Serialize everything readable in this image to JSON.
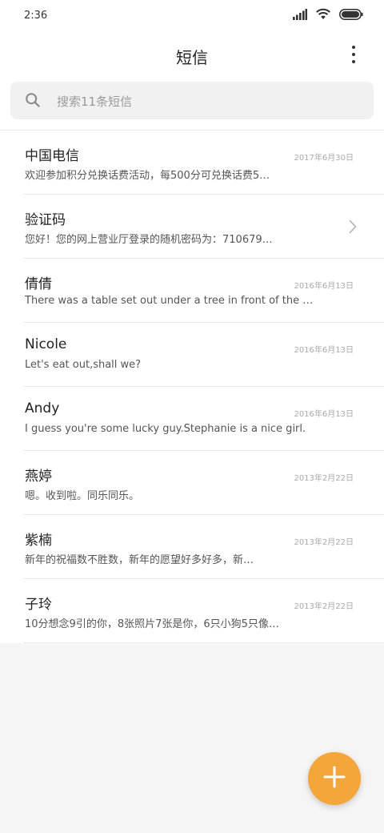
{
  "status_bar": {
    "time": "2:36",
    "icons": [
      "signal-icon",
      "wifi-icon",
      "battery-icon"
    ]
  },
  "header": {
    "title": "短信",
    "menu_icon": "more-vert-icon"
  },
  "search": {
    "placeholder": "搜索11条短信",
    "icon": "search-icon"
  },
  "messages": [
    {
      "name": "中国电信",
      "date": "2017年6月30日",
      "preview": "欢迎参加积分兑换话费活动，每500分可兑换话费5…",
      "chevron": false
    },
    {
      "name": "验证码",
      "date": "",
      "preview": "您好！您的网上营业厅登录的随机密码为：710679…",
      "chevron": true
    },
    {
      "name": "倩倩",
      "date": "2016年6月13日",
      "preview": "There was a table set out under a tree in front of the hous",
      "chevron": false
    },
    {
      "name": "Nicole",
      "date": "2016年6月13日",
      "preview": "Let's eat out,shall we?",
      "chevron": false
    },
    {
      "name": "Andy",
      "date": "2016年6月13日",
      "preview": "I guess you're some lucky guy.Stephanie is a nice girl.",
      "chevron": false
    },
    {
      "name": "燕婷",
      "date": "2013年2月22日",
      "preview": "嗯。收到啦。同乐同乐。",
      "chevron": false
    },
    {
      "name": "紫楠",
      "date": "2013年2月22日",
      "preview": "新年的祝福数不胜数，新年的愿望好多好多，新…",
      "chevron": false
    },
    {
      "name": "子玲",
      "date": "2013年2月22日",
      "preview": "10分想念9引的你，8张照片7张是你，6只小狗5只像…",
      "chevron": false
    }
  ],
  "fab": {
    "icon": "plus-icon",
    "color": "#f5a63a"
  },
  "colors": {
    "background": "#f5f5f5",
    "surface": "#ffffff",
    "accent": "#f5a63a"
  }
}
